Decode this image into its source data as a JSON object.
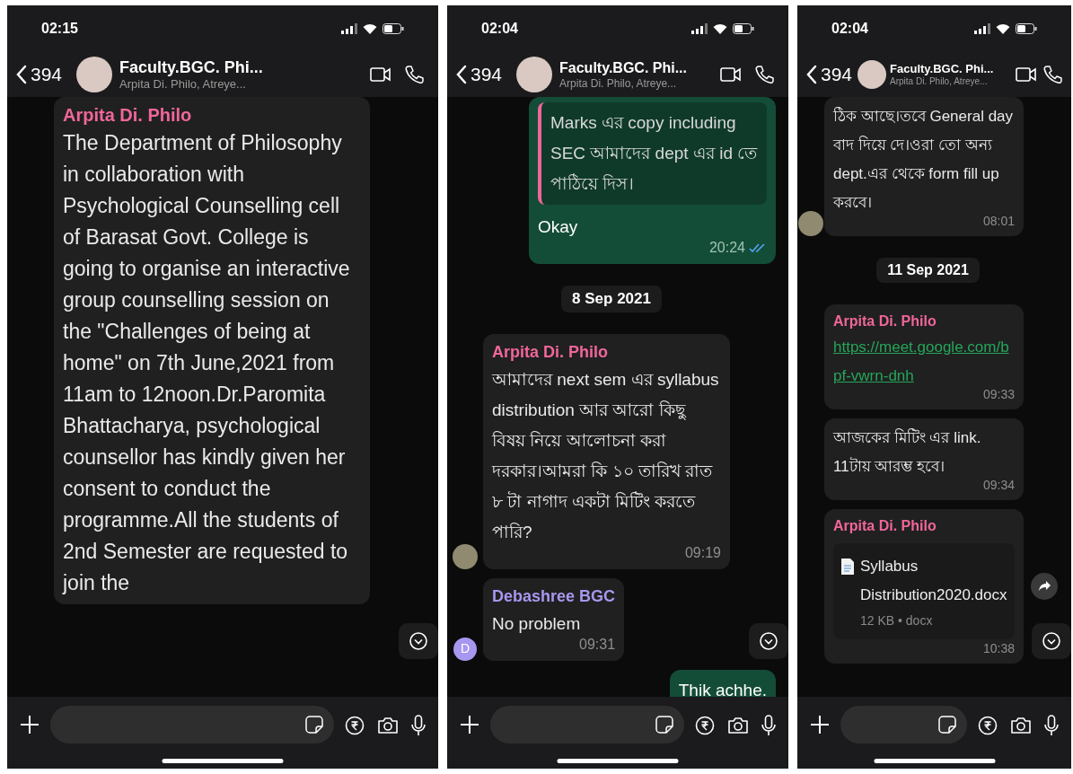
{
  "phones": [
    {
      "status_time": "02:15",
      "header": {
        "back_count": "394",
        "title": "Faculty.BGC. Phi...",
        "subtitle": "Arpita Di. Philo, Atreye..."
      },
      "scroll_button": true,
      "messages": [
        {
          "kind": "incoming",
          "sender": "Arpita Di. Philo",
          "color": "#f0669a",
          "text": "The Department of Philosophy in collaboration with Psychological Counselling  cell of Barasat Govt. College is going to organise an interactive group counselling session on the \"Challenges of being at home\" on 7th June,2021 from 11am to 12noon.Dr.Paromita Bhattacharya, psychological counsellor has kindly given her consent to conduct the programme.All the students of 2nd Semester are requested to join the"
        }
      ]
    },
    {
      "status_time": "02:04",
      "header": {
        "back_count": "394",
        "title": "Faculty.BGC. Phi...",
        "subtitle": "Arpita Di. Philo, Atreye..."
      },
      "scroll_button": true,
      "messages": [
        {
          "kind": "outgoing",
          "quote": {
            "text": "Marks এর copy including SEC আমাদের dept এর id তে পাঠিয়ে দিস।",
            "color": "#f0669a"
          },
          "text": "Okay",
          "time": "20:24",
          "read": true
        },
        {
          "kind": "date",
          "text": "8 Sep 2021"
        },
        {
          "kind": "incoming",
          "sender": "Arpita Di. Philo",
          "color": "#f0669a",
          "text": "আমাদের next sem এর syllabus distribution আর আরো কিছু বিষয় নিয়ে আলোচনা করা দরকার।আমরা কি ১০ তারিখ রাত ৮ টা নাগাদ একটা মিটিং করতে পারি?",
          "time": "09:19",
          "avatar": {
            "kind": "photo"
          }
        },
        {
          "kind": "incoming",
          "sender": "Debashree BGC",
          "color": "#a897f0",
          "text": "No problem",
          "time": "09:31",
          "avatar": {
            "kind": "initial",
            "letter": "D"
          }
        },
        {
          "kind": "outgoing",
          "text": "Thik achhe."
        }
      ]
    },
    {
      "status_time": "02:04",
      "header": {
        "back_count": "394",
        "title": "Faculty.BGC. Phi...",
        "subtitle": "Arpita Di. Philo, Atreye..."
      },
      "scroll_button": true,
      "messages": [
        {
          "kind": "incoming",
          "text": "ঠিক আছে।তবে General day বাদ দিয়ে দে।ওরা তো অন্য dept.এর থেকে form fill up করবে।",
          "time": "08:01",
          "avatar": {
            "kind": "photo"
          }
        },
        {
          "kind": "date",
          "text": "11 Sep 2021"
        },
        {
          "kind": "incoming",
          "sender": "Arpita Di. Philo",
          "color": "#f0669a",
          "link": "https://meet.google.com/bpf-vwrn-dnh",
          "time": "09:33"
        },
        {
          "kind": "incoming",
          "text": "আজকের মিটিং এর link. 11টায় আরম্ভ হবে।",
          "time": "09:34"
        },
        {
          "kind": "file",
          "sender": "Arpita Di. Philo",
          "color": "#f0669a",
          "file_name": "Syllabus Distribution2020.docx",
          "file_meta": "12 KB • docx",
          "time": "10:38",
          "forward": true
        }
      ]
    }
  ]
}
